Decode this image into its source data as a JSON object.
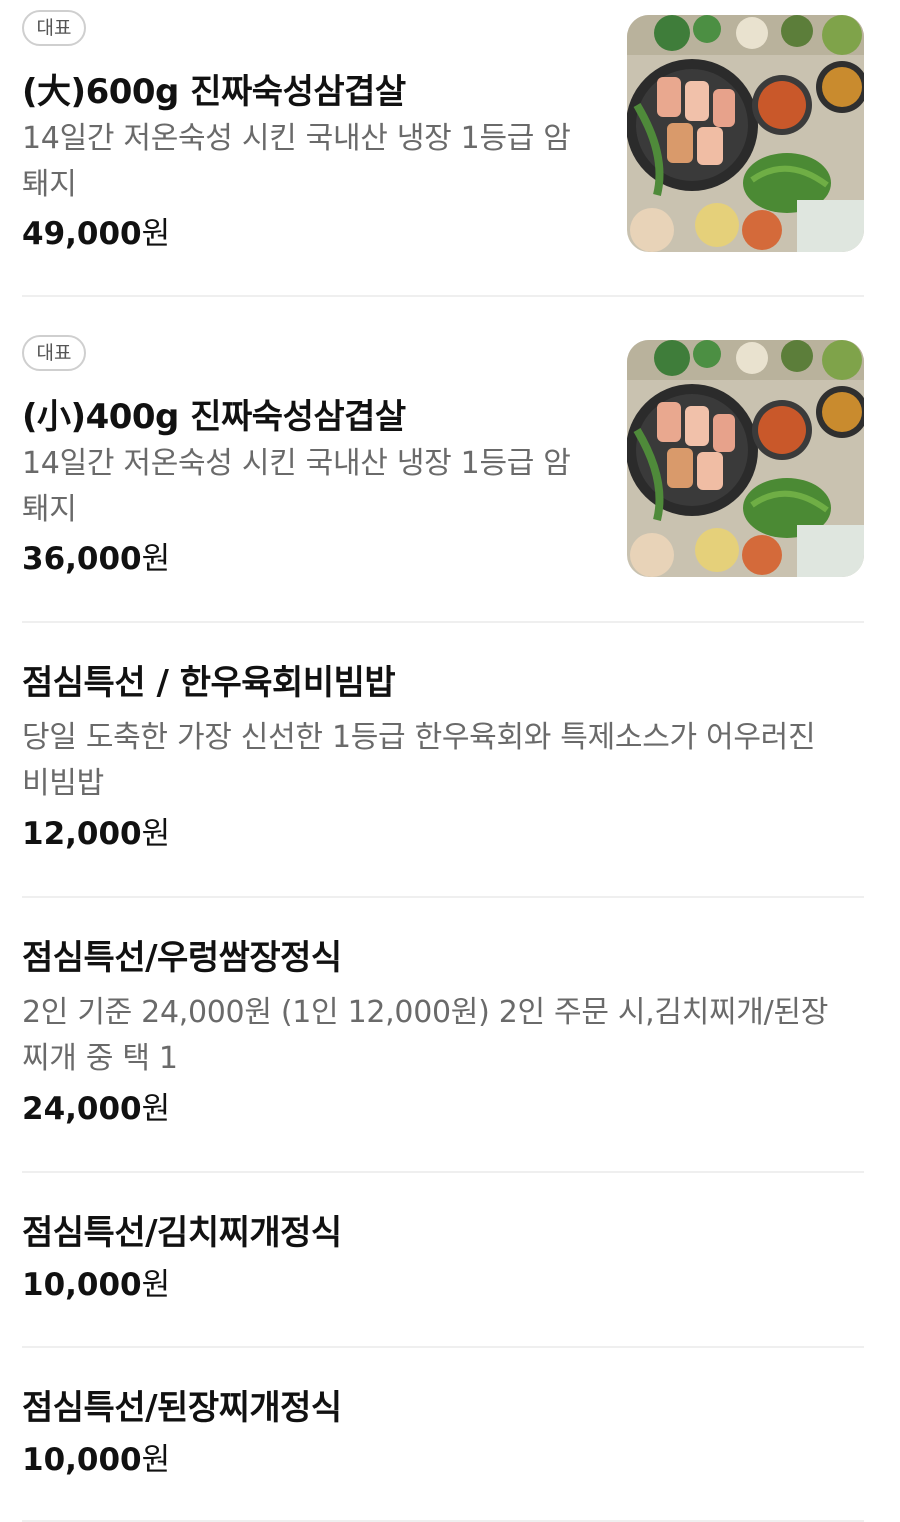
{
  "menu": {
    "items": [
      {
        "badge": "대표",
        "name": "(大)600g 진짜숙성삼겹살",
        "desc_line1": "14일간 저온숙성 시킨 국내산 냉장 1등급 암",
        "desc_line2": "퇘지",
        "price": "49,000",
        "unit": "원"
      },
      {
        "badge": "대표",
        "name": "(小)400g 진짜숙성삼겹살",
        "desc_line1": "14일간 저온숙성 시킨 국내산 냉장 1등급 암",
        "desc_line2": "퇘지",
        "price": "36,000",
        "unit": "원"
      },
      {
        "name": "점심특선 / 한우육회비빔밥",
        "desc_line1": "당일 도축한 가장 신선한 1등급 한우육회와 특제소스가 어우러진",
        "desc_line2": "비빔밥",
        "price": "12,000",
        "unit": "원"
      },
      {
        "name": "점심특선/우렁쌈장정식",
        "desc_line1": "2인 기준 24,000원 (1인 12,000원) 2인 주문 시,김치찌개/된장",
        "desc_line2": "찌개 중 택 1",
        "price": "24,000",
        "unit": "원"
      },
      {
        "name": "점심특선/김치찌개정식",
        "price": "10,000",
        "unit": "원"
      },
      {
        "name": "점심특선/된장찌개정식",
        "price": "10,000",
        "unit": "원"
      }
    ]
  },
  "colors": {
    "name_text": "#111111",
    "desc_text": "#6a6a6a",
    "badge_border": "#cfcfcf",
    "divider": "#efefef"
  },
  "icons": {
    "food_photo": "samgyeopsal-grill-photo"
  }
}
